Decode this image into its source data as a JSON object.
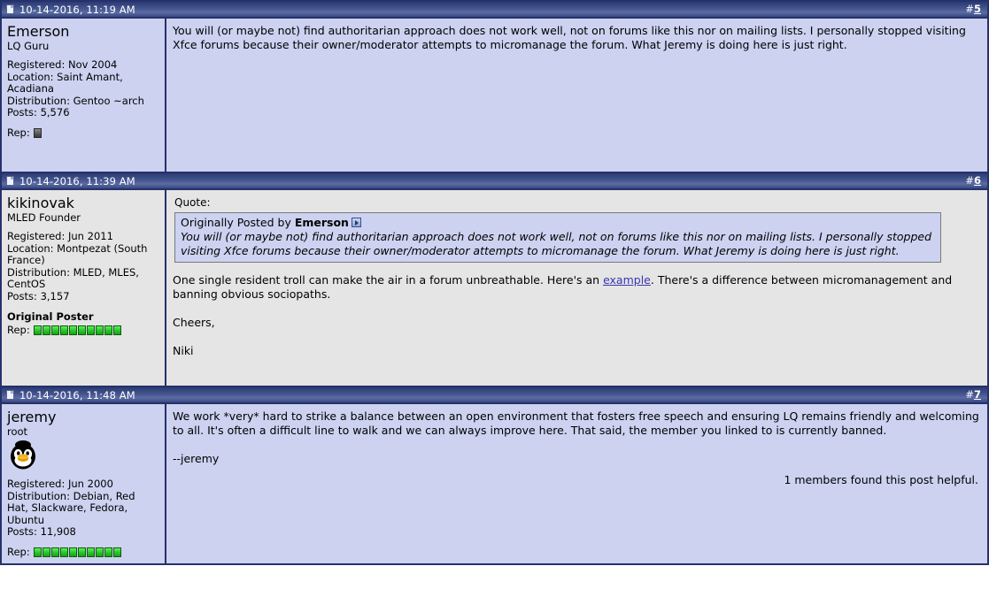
{
  "posts": [
    {
      "theme": "blue",
      "date": "10-14-2016, 11:19 AM",
      "number_hash": "#",
      "number": "5",
      "user": {
        "name": "Emerson",
        "title": "LQ Guru",
        "registered": "Registered: Nov 2004",
        "location": "Location: Saint Amant, Acadiana",
        "distribution": "Distribution: Gentoo ~arch",
        "posts": "Posts: 5,576",
        "rep_label": "Rep:",
        "rep_count": 1,
        "rep_state": "off",
        "original_poster": "",
        "avatar": ""
      },
      "paragraphs": [
        "You will (or maybe not) find authoritarian approach does not work well, not on forums like this nor on mailing lists. I personally stopped visiting Xfce forums because their owner/moderator attempts to micromanage the forum. What Jeremy is doing here is just right."
      ]
    },
    {
      "theme": "gray",
      "date": "10-14-2016, 11:39 AM",
      "number_hash": "#",
      "number": "6",
      "user": {
        "name": "kikinovak",
        "title": "MLED Founder",
        "registered": "Registered: Jun 2011",
        "location": "Location: Montpezat (South France)",
        "distribution": "Distribution: MLED, MLES, CentOS",
        "posts": "Posts: 3,157",
        "rep_label": "Rep:",
        "rep_count": 10,
        "rep_state": "on",
        "original_poster": "Original Poster",
        "avatar": ""
      },
      "quote": {
        "label": "Quote:",
        "attrib_prefix": "Originally Posted by",
        "attrib_author": "Emerson",
        "goto_icon": "goto-post-icon",
        "text": "You will (or maybe not) find authoritarian approach does not work well, not on forums like this nor on mailing lists. I personally stopped visiting Xfce forums because their owner/moderator attempts to micromanage the forum. What Jeremy is doing here is just right."
      },
      "rich_paragraph": {
        "before": "One single resident troll can make the air in a forum unbreathable. Here's an ",
        "link": "example",
        "after": ". There's a difference between micromanagement and banning obvious sociopaths."
      },
      "paragraphs": [
        "Cheers,",
        "Niki"
      ]
    },
    {
      "theme": "blue",
      "date": "10-14-2016, 11:48 AM",
      "number_hash": "#",
      "number": "7",
      "user": {
        "name": "jeremy",
        "title": "root",
        "registered": "Registered: Jun 2000",
        "location": "",
        "distribution": "Distribution: Debian, Red Hat, Slackware, Fedora, Ubuntu",
        "posts": "Posts: 11,908",
        "rep_label": "Rep:",
        "rep_count": 10,
        "rep_state": "on",
        "original_poster": "",
        "avatar": "tux-penguin-avatar"
      },
      "paragraphs": [
        "We work *very* hard to strike a balance between an open environment that fosters free speech and ensuring LQ remains friendly and welcoming to all. It's often a difficult line to walk and we can always improve here. That said, the member you linked to is currently banned.",
        "--jeremy"
      ],
      "helpful": "1 members found this post helpful."
    }
  ],
  "colors": {
    "frame_border": "#26316b",
    "header_gradient_top": "#2b3a72",
    "header_gradient_bottom": "#37477f",
    "body_blue": "#ccd2f0",
    "body_gray": "#e5e5e5",
    "link": "#3a34b0",
    "rep_green": "#29c429",
    "rep_off": "#555555"
  }
}
